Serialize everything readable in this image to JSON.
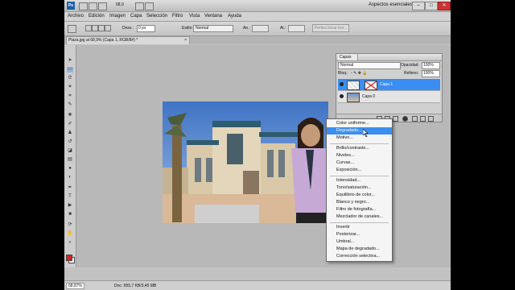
{
  "titlebar": {
    "zoom": "68,9",
    "workspace": "Aspectos esenciales",
    "minimize": "–",
    "maximize": "□",
    "close": "✕"
  },
  "menubar": {
    "items": [
      "Archivo",
      "Edición",
      "Imagen",
      "Capa",
      "Selección",
      "Filtro",
      "Vista",
      "Ventana",
      "Ayuda"
    ]
  },
  "options": {
    "desv_label": "Desv.:",
    "desv_value": "0 px",
    "estilo_label": "Estilo:",
    "estilo_value": "Normal",
    "an_label": "An.:",
    "al_label": "Al.:",
    "refine_button": "Perfeccionar bor..."
  },
  "document": {
    "tab_title": "Plaza.jpg al 68,9% (Capa 1, RGB/8#) *",
    "tab_close": "×"
  },
  "status": {
    "zoom": "68,87%",
    "doc": "Doc: 955,7 KB/3,45 MB"
  },
  "layers_panel": {
    "tab": "Capas",
    "blend_mode": "Normal",
    "opacity_label": "Opacidad:",
    "opacity_value": "100%",
    "lock_label": "Bloq.:",
    "fill_label": "Relleno:",
    "fill_value": "100%",
    "layers": [
      {
        "name": "Capa 1",
        "selected": true
      },
      {
        "name": "Capa 0",
        "selected": false
      }
    ]
  },
  "adjust_menu": {
    "items": [
      "Color uniforme...",
      "Degradado...",
      "Motivo...",
      "Brillo/contraste...",
      "Niveles...",
      "Curvas...",
      "Exposición...",
      "Intensidad...",
      "Tono/saturación...",
      "Equilibrio de color...",
      "Blanco y negro...",
      "Filtro de fotografía...",
      "Mezclador de canales...",
      "Invertir",
      "Posterizar...",
      "Umbral...",
      "Mapa de degradado...",
      "Corrección selectiva..."
    ],
    "highlighted": "Degradado..."
  },
  "colors": {
    "selection": "#3c8fef",
    "foreground": "#e02020",
    "background": "#ffffff",
    "ps_blue": "#1d5fa8"
  }
}
